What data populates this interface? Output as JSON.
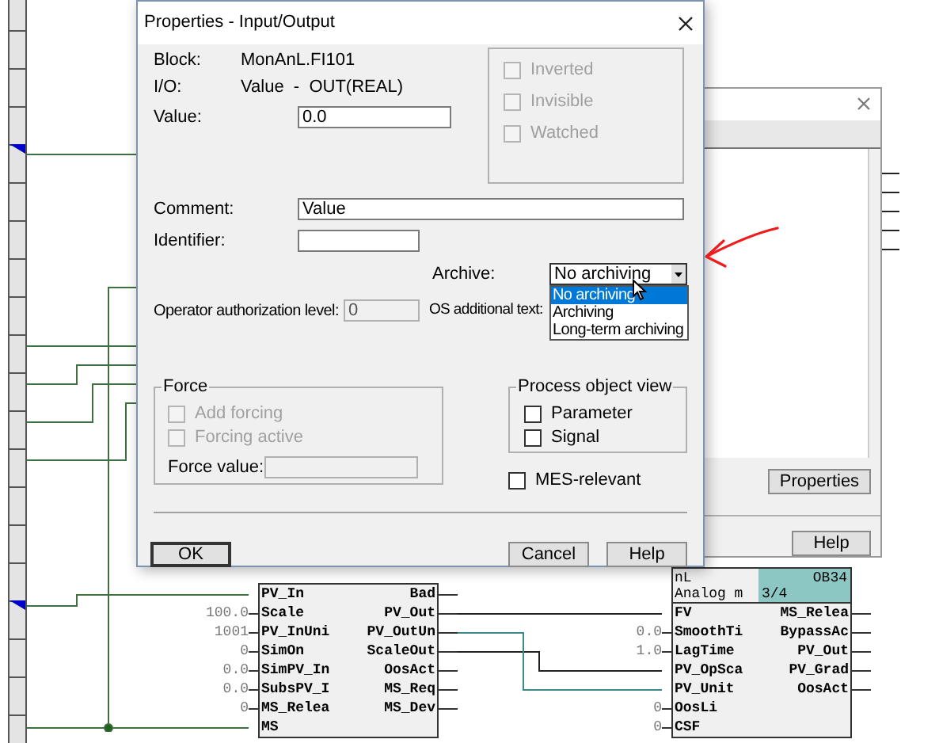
{
  "properties_dialog": {
    "title": "Properties - Input/Output",
    "block": {
      "label": "Block:",
      "value": "MonAnL.FI101"
    },
    "io": {
      "label": "I/O:",
      "value": "Value  -  OUT(REAL)"
    },
    "value_field": {
      "label": "Value:",
      "value": "0.0"
    },
    "flags": [
      {
        "label": "Inverted",
        "checked": false,
        "disabled": true
      },
      {
        "label": "Invisible",
        "checked": false,
        "disabled": true
      },
      {
        "label": "Watched",
        "checked": false,
        "disabled": true
      }
    ],
    "comment": {
      "label": "Comment:",
      "value": "Value"
    },
    "identifier": {
      "label": "Identifier:"
    },
    "archive": {
      "label": "Archive:",
      "value": "No archiving",
      "expanded": true,
      "options": [
        {
          "label": "No archiving",
          "selected": true
        },
        {
          "label": "Archiving",
          "selected": false
        },
        {
          "label": "Long-term archiving",
          "selected": false
        }
      ]
    },
    "operator_level": {
      "label": "Operator authorization level:",
      "value": "0",
      "disabled": true
    },
    "os_text": {
      "label": "OS additional text:"
    },
    "force": {
      "title": "Force",
      "options": [
        {
          "label": "Add forcing",
          "checked": false,
          "disabled": true
        },
        {
          "label": "Forcing active",
          "checked": false,
          "disabled": true
        }
      ],
      "value_label": "Force value:"
    },
    "process_object_view": {
      "title": "Process object view",
      "options": [
        {
          "label": "Parameter",
          "checked": false,
          "disabled": false
        },
        {
          "label": "Signal",
          "checked": false,
          "disabled": false
        }
      ]
    },
    "mes_relevant": {
      "label": "MES-relevant",
      "checked": false,
      "disabled": false
    },
    "buttons": [
      {
        "label": "OK",
        "kind": "default"
      },
      {
        "label": "Cancel",
        "kind": "normal"
      },
      {
        "label": "Help",
        "kind": "normal"
      }
    ]
  },
  "background_dialog": {
    "buttons": [
      "Properties",
      "Help"
    ]
  },
  "blocks": [
    {
      "inputs": [
        {
          "name": "PV_In"
        },
        {
          "name": "Scale",
          "value": "100.0"
        },
        {
          "name": "PV_InUni",
          "value": "1001"
        },
        {
          "name": "SimOn",
          "value": "0"
        },
        {
          "name": "SimPV_In",
          "value": "0.0"
        },
        {
          "name": "SubsPV_I",
          "value": "0.0"
        },
        {
          "name": "MS_Relea",
          "value": "0"
        },
        {
          "name": "MS"
        }
      ],
      "outputs": [
        "Bad",
        "PV_Out",
        "PV_OutUn",
        "ScaleOut",
        "OosAct",
        "MS_Req",
        "MS_Dev"
      ]
    },
    {
      "header": [
        "nL",
        "Analog m"
      ],
      "badge": [
        "OB34",
        "3/4"
      ],
      "inputs": [
        {
          "name": "FV"
        },
        {
          "name": "SmoothTi",
          "value": "0.0"
        },
        {
          "name": "LagTime",
          "value": "1.0"
        },
        {
          "name": "PV_OpSca"
        },
        {
          "name": "PV_Unit"
        },
        {
          "name": "OosLi",
          "value": "0"
        },
        {
          "name": "CSF",
          "value": "0"
        }
      ],
      "outputs": [
        "MS_Relea",
        "BypassAc",
        "PV_Out",
        "PV_Grad",
        "OosAct"
      ]
    }
  ]
}
